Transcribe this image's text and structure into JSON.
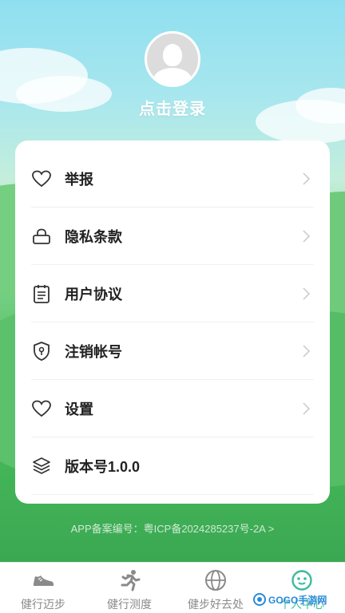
{
  "profile": {
    "login_label": "点击登录"
  },
  "menu": [
    {
      "label": "举报",
      "icon": "heart-icon",
      "has_arrow": true
    },
    {
      "label": "隐私条款",
      "icon": "lock-icon",
      "has_arrow": true
    },
    {
      "label": "用户协议",
      "icon": "clipboard-icon",
      "has_arrow": true
    },
    {
      "label": "注销帐号",
      "icon": "shield-icon",
      "has_arrow": true
    },
    {
      "label": "设置",
      "icon": "heart-icon",
      "has_arrow": true
    },
    {
      "label": "版本号1.0.0",
      "icon": "layers-icon",
      "has_arrow": false
    }
  ],
  "footer": {
    "icp": "APP备案编号：粤ICP备2024285237号-2A >"
  },
  "tabs": [
    {
      "label": "健行迈步",
      "icon": "shoe-icon",
      "active": false
    },
    {
      "label": "健行测度",
      "icon": "runner-icon",
      "active": false
    },
    {
      "label": "健步好去处",
      "icon": "globe-icon",
      "active": false
    },
    {
      "label": "个人中心",
      "icon": "smiley-icon",
      "active": true
    }
  ],
  "watermark": {
    "text": "GOGO手游网"
  },
  "colors": {
    "accent": "#3dbb9f",
    "text": "#222222",
    "muted": "#8a8a8a"
  }
}
